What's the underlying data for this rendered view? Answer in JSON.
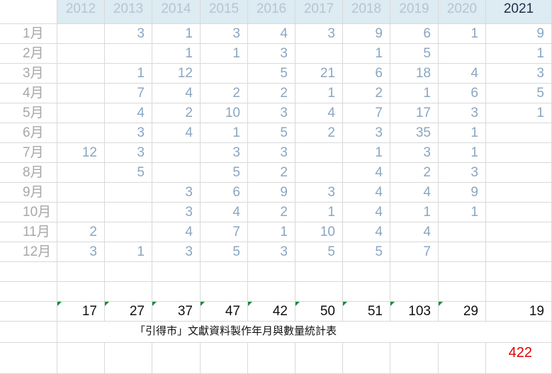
{
  "sheet": {
    "years": [
      "2012",
      "2013",
      "2014",
      "2015",
      "2016",
      "2017",
      "2018",
      "2019",
      "2020",
      "2021"
    ],
    "active_year_index": 9,
    "months": [
      "1月",
      "2月",
      "3月",
      "4月",
      "5月",
      "6月",
      "7月",
      "8月",
      "9月",
      "10月",
      "11月",
      "12月"
    ],
    "values": [
      [
        "",
        "3",
        "1",
        "3",
        "4",
        "3",
        "9",
        "6",
        "1",
        "9"
      ],
      [
        "",
        "",
        "1",
        "1",
        "3",
        "",
        "1",
        "5",
        "",
        "1"
      ],
      [
        "",
        "1",
        "12",
        "",
        "5",
        "21",
        "6",
        "18",
        "4",
        "3"
      ],
      [
        "",
        "7",
        "4",
        "2",
        "2",
        "1",
        "2",
        "1",
        "6",
        "5"
      ],
      [
        "",
        "4",
        "2",
        "10",
        "3",
        "4",
        "7",
        "17",
        "3",
        "1"
      ],
      [
        "",
        "3",
        "4",
        "1",
        "5",
        "2",
        "3",
        "35",
        "1",
        ""
      ],
      [
        "12",
        "3",
        "",
        "3",
        "3",
        "",
        "1",
        "3",
        "1",
        ""
      ],
      [
        "",
        "5",
        "",
        "5",
        "2",
        "",
        "4",
        "2",
        "3",
        ""
      ],
      [
        "",
        "",
        "3",
        "6",
        "9",
        "3",
        "4",
        "4",
        "9",
        ""
      ],
      [
        "",
        "",
        "3",
        "4",
        "2",
        "1",
        "4",
        "1",
        "1",
        ""
      ],
      [
        "2",
        "",
        "4",
        "7",
        "1",
        "10",
        "4",
        "4",
        "",
        ""
      ],
      [
        "3",
        "1",
        "3",
        "5",
        "3",
        "5",
        "5",
        "7",
        "",
        ""
      ]
    ],
    "totals": [
      "17",
      "27",
      "37",
      "47",
      "42",
      "50",
      "51",
      "103",
      "29",
      "19"
    ],
    "caption": "「引得市」文獻資料製作年月與數量統計表",
    "grand_total": "422",
    "colors": {
      "header_bg": "#ddebf2",
      "header_text": "#b4c6d4",
      "header_active_text": "#1f2f46",
      "value_text": "#8aa6c1",
      "month_text": "#a7a7a7",
      "total_text": "#111111",
      "grand_total_text": "#e00000",
      "error_indicator": "#1b8a3a"
    }
  }
}
